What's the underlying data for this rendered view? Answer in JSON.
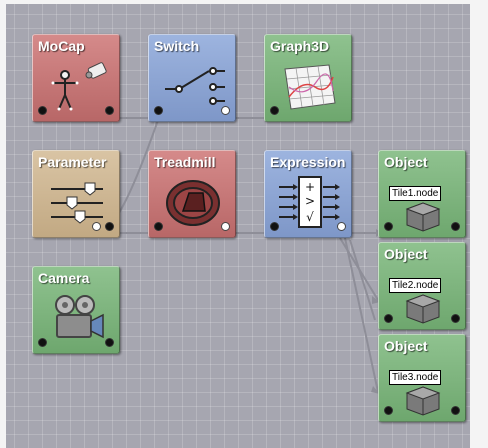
{
  "nodes": {
    "mocap": {
      "title": "MoCap",
      "icon": "motion-capture-figure-icon"
    },
    "switch": {
      "title": "Switch",
      "icon": "switch-lever-icon"
    },
    "graph3d": {
      "title": "Graph3D",
      "icon": "3d-graph-icon"
    },
    "parameter": {
      "title": "Parameter",
      "icon": "sliders-icon"
    },
    "treadmill": {
      "title": "Treadmill",
      "icon": "treadmill-icon"
    },
    "expression": {
      "title": "Expression",
      "icon": "expression-operator-icon"
    },
    "camera": {
      "title": "Camera",
      "icon": "camera-icon"
    },
    "objects": [
      {
        "title": "Object",
        "file": "Tile1.node"
      },
      {
        "title": "Object",
        "file": "Tile2.node"
      },
      {
        "title": "Object",
        "file": "Tile3.node"
      }
    ]
  },
  "colors": {
    "background": "#a6a6b0",
    "source_node": "#c97878",
    "operator_node": "#8ea6d4",
    "output_node": "#7fb57f",
    "parameter_node": "#cfb794",
    "wire": "#8e8e98"
  }
}
